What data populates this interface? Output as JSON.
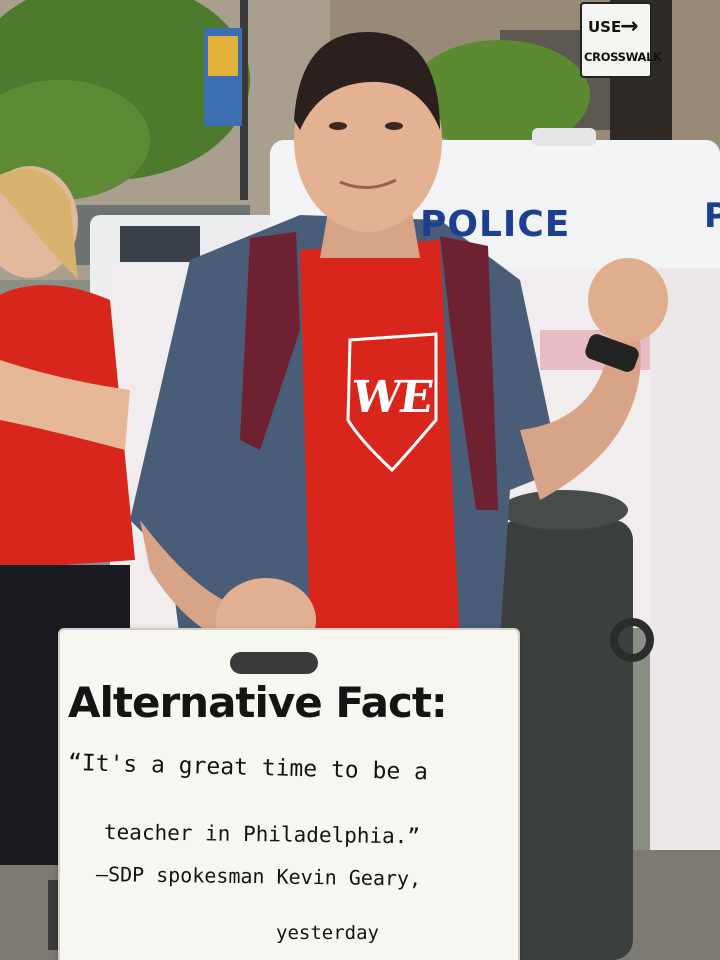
{
  "street_sign": {
    "line1": "USE",
    "arrow": "→",
    "line2": "CROSSWALK"
  },
  "vehicle": {
    "text": "POLICE",
    "text_right": "P"
  },
  "shirt": {
    "logo_text": "WE"
  },
  "protest_sign": {
    "title": "Alternative Fact:",
    "line2": "“It's a great time to be a",
    "line3": "teacher in Philadelphia.”",
    "line4": "–SDP spokesman Kevin Geary,",
    "line5": "yesterday"
  },
  "colors": {
    "shirt_red": "#d9261d",
    "police_blue": "#1d3f8f",
    "plaid_shirt": "#4a5d78",
    "backpack": "#6e2231",
    "bollard": "#3b3f3e",
    "sign_paper": "#f7f6f1"
  }
}
